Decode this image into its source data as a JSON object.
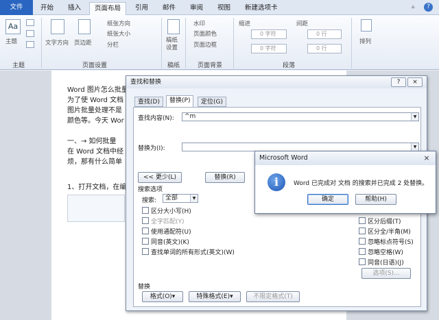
{
  "ribbon_tabs": [
    "文件",
    "开始",
    "插入",
    "页面布局",
    "引用",
    "邮件",
    "审阅",
    "视图",
    "新建选项卡"
  ],
  "active_tab": "页面布局",
  "ribbon": {
    "theme_label": "主题",
    "theme_group": "主题",
    "text_direction": "文字方向",
    "margins": "页边距",
    "orientation": "纸张方向",
    "size": "纸张大小",
    "columns": "分栏",
    "page_setup_group": "页面设置",
    "manuscript": "稿纸\n设置",
    "manuscript_group": "稿纸",
    "watermark": "水印",
    "page_color": "页面颜色",
    "page_border": "页面边框",
    "page_bg_group": "页面背景",
    "indent": "缩进",
    "spacing": "间距",
    "indent_left": "0 字符",
    "indent_right": "0 字符",
    "spacing_before": "0 行",
    "spacing_after": "0 行",
    "paragraph_group": "段落",
    "arrange": "排列"
  },
  "document": {
    "lines": [
      "Word 图片怎么批量",
      "为了使 Word 文档",
      "图片批量处理不是",
      "颜色等。今天 Wor",
      "一、→ 如何批量",
      "在 Word 文档中经",
      "烦，那有什么简单",
      "1、打开文档，在编"
    ]
  },
  "find_dialog": {
    "title": "查找和替换",
    "help": "?",
    "close": "×",
    "tabs": [
      "查找(D)",
      "替换(P)",
      "定位(G)"
    ],
    "find_label": "查找内容(N):",
    "find_value": "^m",
    "replace_label": "替换为(I):",
    "replace_value": "",
    "less_button": "<< 更少(L)",
    "replace_button": "替换(R)",
    "search_options": "搜索选项",
    "search_label": "搜索:",
    "search_value": "全部",
    "left_options": [
      "区分大小写(H)",
      "全字匹配(Y)",
      "使用通配符(U)",
      "同音(英文)(K)",
      "查找单词的所有形式(英文)(W)"
    ],
    "right_options": [
      "区分前缀(X)",
      "区分后缀(T)",
      "区分全/半角(M)",
      "忽略标点符号(S)",
      "忽略空格(W)",
      "同音(日语)(J)"
    ],
    "options_button": "选项(S)...",
    "replace_section": "替换",
    "format_button": "格式(O)▾",
    "special_button": "特殊格式(E)▾",
    "no_format_button": "不限定格式(T)"
  },
  "msgbox": {
    "title": "Microsoft Word",
    "close": "×",
    "message": "Word 已完成对 文档 的搜索并已完成 2 处替换。",
    "ok": "确定",
    "help": "帮助(H)"
  }
}
